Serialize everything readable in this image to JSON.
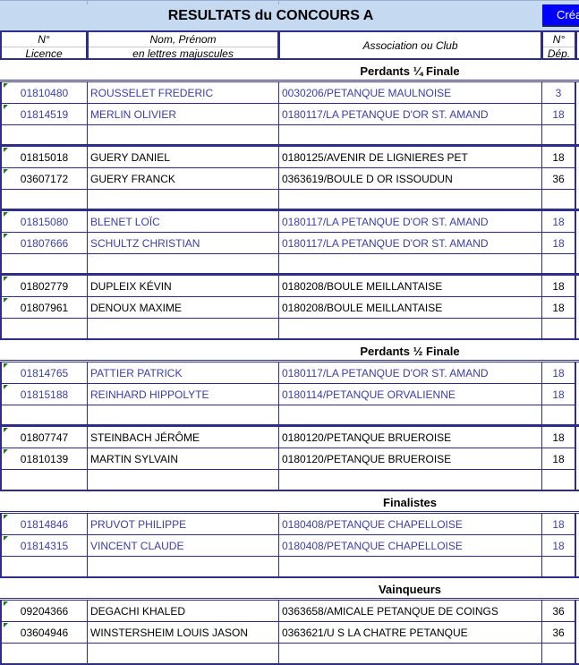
{
  "title": "RESULTATS du CONCOURS A",
  "create_button_label": "Créa",
  "headers": {
    "licence": [
      "N°",
      "Licence"
    ],
    "name": [
      "Nom, Prénom",
      "en lettres majuscules"
    ],
    "club": "Association ou Club",
    "dep": [
      "N°",
      "Dép."
    ]
  },
  "colors": {
    "blue_text": "#3c3ca8",
    "border": "#2e2e8a",
    "title_bg": "#c5d9f1",
    "button_bg": "#0000ff"
  },
  "sections": [
    {
      "label": "Perdants ¼ Finale",
      "groups": [
        {
          "color": "blue",
          "players": [
            {
              "licence": "01810480",
              "name": "ROUSSELET FREDERIC",
              "club": "0030206/PETANQUE MAULNOISE",
              "dep": "3"
            },
            {
              "licence": "01814519",
              "name": "MERLIN OLIVIER",
              "club": "0180117/LA PETANQUE D'OR ST. AMAND",
              "dep": "18"
            }
          ]
        },
        {
          "color": "black",
          "players": [
            {
              "licence": "01815018",
              "name": "GUERY DANIEL",
              "club": "0180125/AVENIR DE LIGNIERES PET",
              "dep": "18"
            },
            {
              "licence": "03607172",
              "name": "GUERY FRANCK",
              "club": "0363619/BOULE D OR ISSOUDUN",
              "dep": "36"
            }
          ]
        },
        {
          "color": "blue",
          "players": [
            {
              "licence": "01815080",
              "name": "BLENET LOÏC",
              "club": "0180117/LA PETANQUE D'OR ST. AMAND",
              "dep": "18"
            },
            {
              "licence": "01807666",
              "name": "SCHULTZ CHRISTIAN",
              "club": "0180117/LA PETANQUE D'OR ST. AMAND",
              "dep": "18"
            }
          ]
        },
        {
          "color": "black",
          "players": [
            {
              "licence": "01802779",
              "name": "DUPLEIX KÉVIN",
              "club": "0180208/BOULE MEILLANTAISE",
              "dep": "18"
            },
            {
              "licence": "01807961",
              "name": "DENOUX MAXIME",
              "club": "0180208/BOULE MEILLANTAISE",
              "dep": "18"
            }
          ]
        }
      ]
    },
    {
      "label": "Perdants ½ Finale",
      "groups": [
        {
          "color": "blue",
          "players": [
            {
              "licence": "01814765",
              "name": "PATTIER PATRICK",
              "club": "0180117/LA PETANQUE D'OR ST. AMAND",
              "dep": "18"
            },
            {
              "licence": "01815188",
              "name": "REINHARD HIPPOLYTE",
              "club": "0180114/PETANQUE ORVALIENNE",
              "dep": "18"
            }
          ]
        },
        {
          "color": "black",
          "players": [
            {
              "licence": "01807747",
              "name": "STEINBACH JÉRÔME",
              "club": "0180120/PETANQUE BRUEROISE",
              "dep": "18"
            },
            {
              "licence": "01810139",
              "name": "MARTIN SYLVAIN",
              "club": "0180120/PETANQUE BRUEROISE",
              "dep": "18"
            }
          ]
        }
      ]
    },
    {
      "label": "Finalistes",
      "groups": [
        {
          "color": "blue",
          "players": [
            {
              "licence": "01814846",
              "name": "PRUVOT PHILIPPE",
              "club": "0180408/PETANQUE CHAPELLOISE",
              "dep": "18"
            },
            {
              "licence": "01814315",
              "name": "VINCENT CLAUDE",
              "club": "0180408/PETANQUE CHAPELLOISE",
              "dep": "18"
            }
          ]
        }
      ]
    },
    {
      "label": "Vainqueurs",
      "groups": [
        {
          "color": "black",
          "players": [
            {
              "licence": "09204366",
              "name": "DEGACHI KHALED",
              "club": "0363658/AMICALE PETANQUE DE COINGS",
              "dep": "36"
            },
            {
              "licence": "03604946",
              "name": "WINSTERSHEIM LOUIS JASON",
              "club": "0363621/U S  LA CHATRE PETANQUE",
              "dep": "36"
            }
          ]
        }
      ]
    }
  ]
}
